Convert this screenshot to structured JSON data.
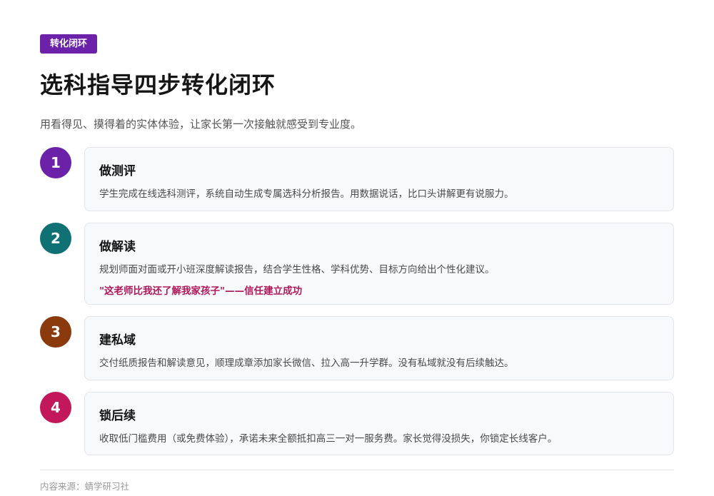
{
  "tag": "转化闭环",
  "title": "选科指导四步转化闭环",
  "subtitle": "用看得见、摸得着的实体体验，让家长第一次接触就感受到专业度。",
  "steps": [
    {
      "number": "1",
      "color": "#6b21a8",
      "title": "做测评",
      "desc": "学生完成在线选科测评，系统自动生成专属选科分析报告。用数据说话，比口头讲解更有说服力。"
    },
    {
      "number": "2",
      "color": "#0f7173",
      "title": "做解读",
      "desc": "规划师面对面或开小班深度解读报告，结合学生性格、学科优势、目标方向给出个性化建议。",
      "quote": "\"这老师比我还了解我家孩子\"——信任建立成功"
    },
    {
      "number": "3",
      "color": "#8a3a0c",
      "title": "建私域",
      "desc": "交付纸质报告和解读意见，顺理成章添加家长微信、拉入高一升学群。没有私域就没有后续触达。"
    },
    {
      "number": "4",
      "color": "#c2185b",
      "title": "锁后续",
      "desc": "收取低门槛费用（或免费体验），承诺未来全额抵扣高三一对一服务费。家长觉得没损失，你锁定长线客户。"
    }
  ],
  "source": "内容来源：蜻学研习社"
}
